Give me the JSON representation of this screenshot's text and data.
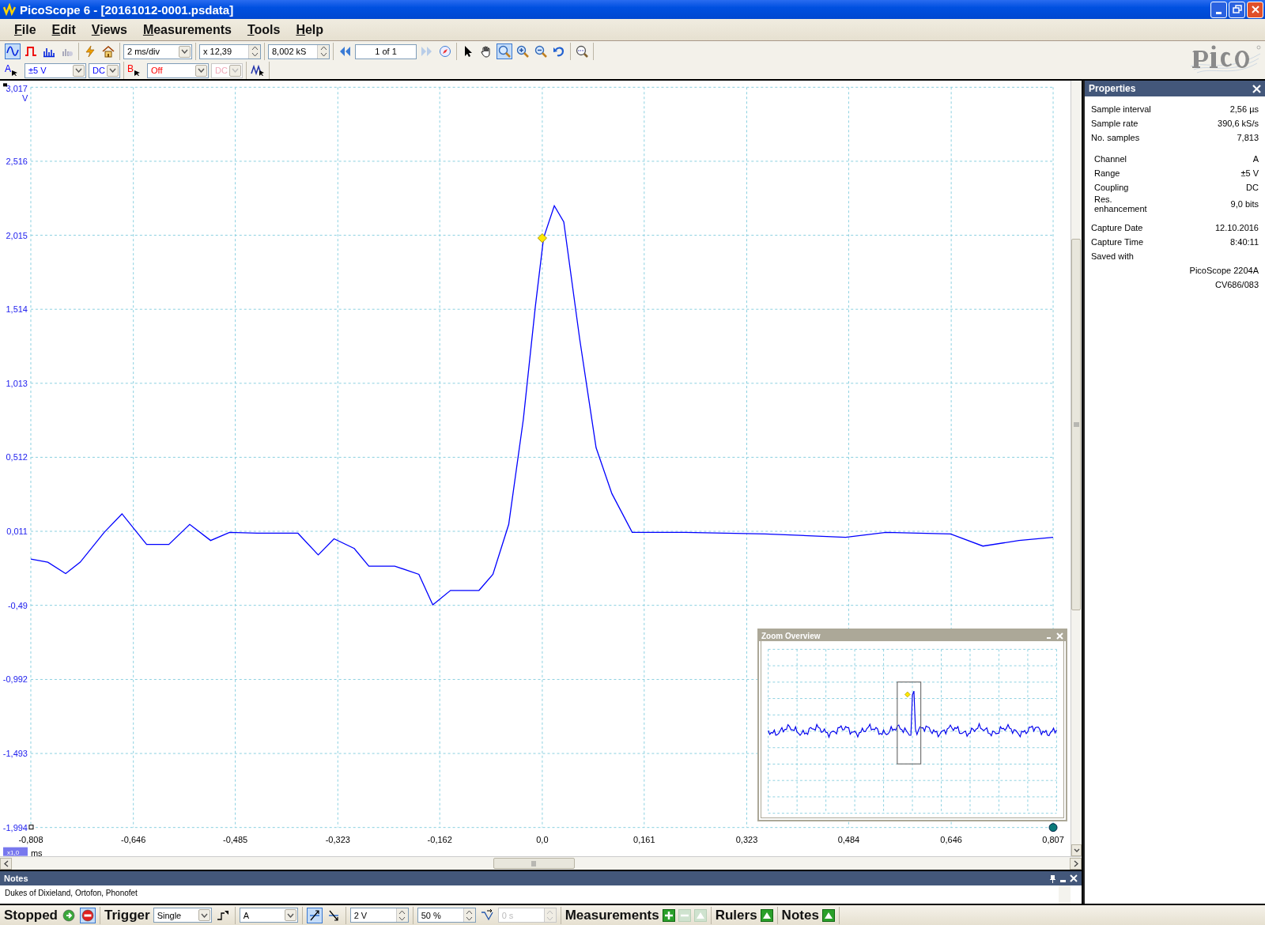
{
  "window": {
    "title": "PicoScope 6 - [20161012-0001.psdata]"
  },
  "menu": [
    "File",
    "Edit",
    "Views",
    "Measurements",
    "Tools",
    "Help"
  ],
  "toolbar": {
    "views": [
      {
        "kind": "scope",
        "selected": true
      },
      {
        "kind": "persistence",
        "selected": false
      },
      {
        "kind": "spectrum",
        "selected": false
      }
    ],
    "timebase": "2 ms/div",
    "zoom": "x 12,39",
    "samples": "8,002 kS",
    "page": "1 of 1",
    "tools": [
      {
        "kind": "pointer",
        "selected": false
      },
      {
        "kind": "hand",
        "selected": false
      },
      {
        "kind": "zoom",
        "selected": true
      },
      {
        "kind": "zoom-in",
        "selected": false
      },
      {
        "kind": "zoom-out",
        "selected": false
      },
      {
        "kind": "undo",
        "selected": false
      }
    ]
  },
  "channels": [
    {
      "label": "A",
      "range": "±5 V",
      "coupling": "DC",
      "disabled": false,
      "color": "#0000ff"
    },
    {
      "label": "B",
      "range": "Off",
      "coupling": "DC",
      "disabled": true,
      "color": "#ff0000"
    }
  ],
  "scope": {
    "x_scale": "x1,0",
    "chart_data": {
      "type": "line",
      "grid": true,
      "xlabel": "ms",
      "ylabel": "V",
      "xlim": [
        -0.808,
        0.807
      ],
      "ylim": [
        -1.994,
        3.017
      ],
      "xticks": [
        {
          "value": -0.808,
          "label": "-0,808"
        },
        {
          "value": -0.646,
          "label": "-0,646"
        },
        {
          "value": -0.485,
          "label": "-0,485"
        },
        {
          "value": -0.323,
          "label": "-0,323"
        },
        {
          "value": -0.162,
          "label": "-0,162"
        },
        {
          "value": 0,
          "label": "0,0"
        },
        {
          "value": 0.161,
          "label": "0,161"
        },
        {
          "value": 0.323,
          "label": "0,323"
        },
        {
          "value": 0.484,
          "label": "0,484"
        },
        {
          "value": 0.646,
          "label": "0,646"
        },
        {
          "value": 0.807,
          "label": "0,807"
        }
      ],
      "yticks": [
        {
          "value": 3.017,
          "label": "3,017"
        },
        {
          "value": 2.516,
          "label": "2,516"
        },
        {
          "value": 2.015,
          "label": "2,015"
        },
        {
          "value": 1.514,
          "label": "1,514"
        },
        {
          "value": 1.013,
          "label": "1,013"
        },
        {
          "value": 0.512,
          "label": "0,512"
        },
        {
          "value": 0.011,
          "label": "0,011"
        },
        {
          "value": -0.49,
          "label": "-0,49"
        },
        {
          "value": -0.992,
          "label": "-0,992"
        },
        {
          "value": -1.493,
          "label": "-1,493"
        },
        {
          "value": -1.994,
          "label": "-1,994"
        }
      ],
      "x": [
        -0.808,
        -0.781,
        -0.753,
        -0.73,
        -0.692,
        -0.664,
        -0.625,
        -0.59,
        -0.557,
        -0.524,
        -0.494,
        -0.45,
        -0.386,
        -0.354,
        -0.329,
        -0.297,
        -0.274,
        -0.233,
        -0.195,
        -0.173,
        -0.145,
        -0.1,
        -0.078,
        -0.053,
        -0.03,
        -0.011,
        0.002,
        0.019,
        0.034,
        0.059,
        0.085,
        0.11,
        0.142,
        0.225,
        0.352,
        0.479,
        0.543,
        0.645,
        0.696,
        0.753,
        0.807
      ],
      "series": [
        {
          "color": "#0000ff",
          "values": [
            -0.176,
            -0.198,
            -0.275,
            -0.198,
            0.004,
            0.129,
            -0.078,
            -0.078,
            0.058,
            -0.051,
            0.004,
            -0.002,
            -0.002,
            -0.149,
            -0.04,
            -0.105,
            -0.225,
            -0.225,
            -0.28,
            -0.487,
            -0.389,
            -0.389,
            -0.28,
            0.058,
            0.768,
            1.532,
            1.996,
            2.215,
            2.105,
            1.314,
            0.577,
            0.266,
            0.004,
            0.004,
            -0.007,
            -0.029,
            0.004,
            -0.007,
            -0.089,
            -0.051,
            -0.029
          ]
        }
      ]
    }
  },
  "zoom_overview": {
    "title": "Zoom Overview"
  },
  "properties": {
    "title": "Properties",
    "groups": [
      [
        {
          "label": "Sample interval",
          "value": "2,56 µs"
        },
        {
          "label": "Sample rate",
          "value": "390,6 kS/s"
        },
        {
          "label": "No. samples",
          "value": "7,813"
        }
      ],
      [
        {
          "label": "Channel",
          "value": "A"
        },
        {
          "label": "Range",
          "value": "±5 V"
        },
        {
          "label": "Coupling",
          "value": "DC"
        },
        {
          "label": "Res. enhancement",
          "value": "9,0 bits"
        }
      ],
      [
        {
          "label": "Capture Date",
          "value": "12.10.2016"
        },
        {
          "label": "Capture Time",
          "value": "8:40:11"
        },
        {
          "label": "Saved with"
        },
        {
          "value": "PicoScope 2204A"
        },
        {
          "value": "CV686/083"
        }
      ]
    ]
  },
  "notes": {
    "title": "Notes",
    "text": "Dukes of Dixieland, Ortofon, Phonofet"
  },
  "status_bar": {
    "state": "Stopped",
    "run_controls": [
      {
        "kind": "run",
        "selected": false
      },
      {
        "kind": "stop",
        "selected": true
      }
    ],
    "trigger_label": "Trigger",
    "trigger_mode": "Single",
    "trigger_source": "A",
    "edges": [
      {
        "kind": "rising",
        "selected": true
      },
      {
        "kind": "falling",
        "selected": false
      }
    ],
    "threshold": "2 V",
    "pretrigger": "50 %",
    "delay": "0 s",
    "sections": [
      {
        "label": "Measurements",
        "buttons": [
          {
            "kind": "add",
            "disabled": false
          },
          {
            "kind": "remove",
            "disabled": true
          },
          {
            "kind": "up",
            "disabled": true
          }
        ]
      },
      {
        "label": "Rulers",
        "buttons": [
          {
            "kind": "up",
            "disabled": false
          }
        ]
      },
      {
        "label": "Notes",
        "buttons": [
          {
            "kind": "up",
            "disabled": false
          }
        ]
      }
    ]
  }
}
